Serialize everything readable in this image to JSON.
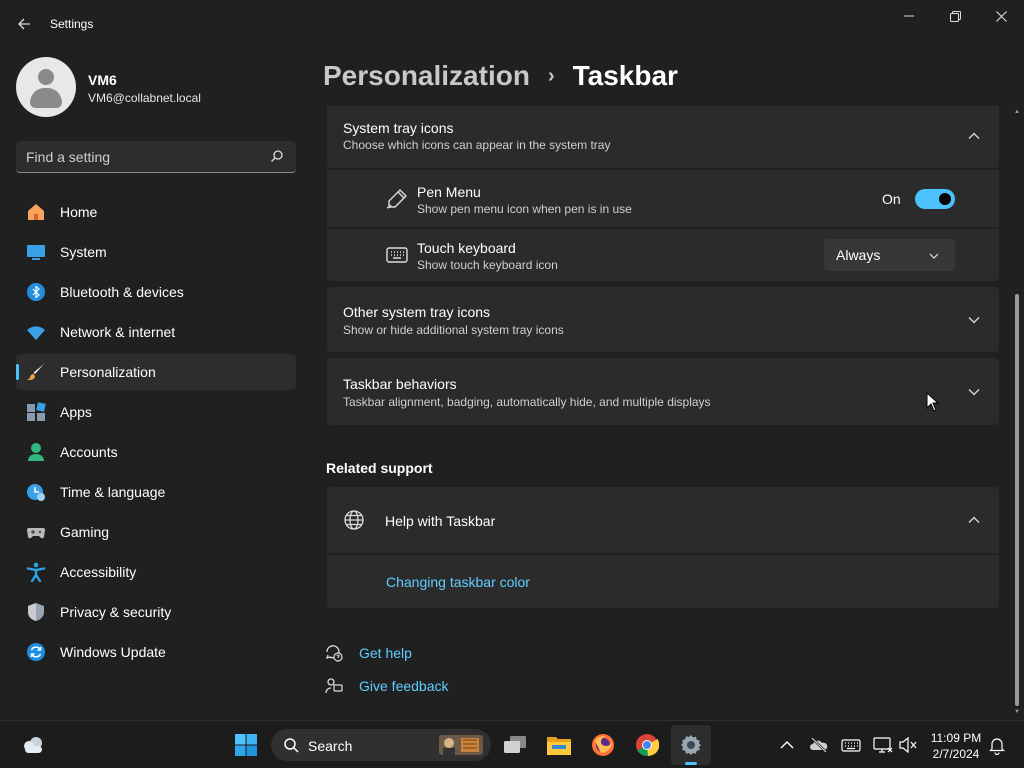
{
  "window": {
    "title": "Settings",
    "controls": [
      "minimize",
      "maximize",
      "close"
    ]
  },
  "profile": {
    "name": "VM6",
    "email": "VM6@collabnet.local"
  },
  "search": {
    "placeholder": "Find a setting"
  },
  "sidebar": {
    "items": [
      {
        "label": "Home",
        "icon": "home-icon"
      },
      {
        "label": "System",
        "icon": "system-icon"
      },
      {
        "label": "Bluetooth & devices",
        "icon": "bluetooth-icon"
      },
      {
        "label": "Network & internet",
        "icon": "wifi-icon"
      },
      {
        "label": "Personalization",
        "icon": "brush-icon",
        "active": true
      },
      {
        "label": "Apps",
        "icon": "apps-icon"
      },
      {
        "label": "Accounts",
        "icon": "accounts-icon"
      },
      {
        "label": "Time & language",
        "icon": "time-language-icon"
      },
      {
        "label": "Gaming",
        "icon": "gaming-icon"
      },
      {
        "label": "Accessibility",
        "icon": "accessibility-icon"
      },
      {
        "label": "Privacy & security",
        "icon": "shield-icon"
      },
      {
        "label": "Windows Update",
        "icon": "update-icon"
      }
    ]
  },
  "breadcrumb": {
    "parent": "Personalization",
    "separator": "›",
    "current": "Taskbar"
  },
  "system_tray": {
    "title": "System tray icons",
    "subtitle": "Choose which icons can appear in the system tray",
    "expanded": true,
    "pen_menu": {
      "title": "Pen Menu",
      "subtitle": "Show pen menu icon when pen is in use",
      "state_label": "On",
      "on": true
    },
    "touch_keyboard": {
      "title": "Touch keyboard",
      "subtitle": "Show touch keyboard icon",
      "value": "Always"
    }
  },
  "other_tray": {
    "title": "Other system tray icons",
    "subtitle": "Show or hide additional system tray icons"
  },
  "behaviors": {
    "title": "Taskbar behaviors",
    "subtitle": "Taskbar alignment, badging, automatically hide, and multiple displays"
  },
  "related": {
    "heading": "Related support",
    "help_title": "Help with Taskbar",
    "help_link": "Changing taskbar color"
  },
  "footer_links": {
    "get_help": "Get help",
    "give_feedback": "Give feedback"
  },
  "taskbar": {
    "search_label": "Search",
    "apps": [
      "start-icon",
      "task-view-icon",
      "file-explorer-icon",
      "firefox-icon",
      "chrome-icon",
      "settings-app-icon"
    ],
    "time": "11:09 PM",
    "date": "2/7/2024"
  },
  "colors": {
    "accent": "#4cc2ff",
    "link": "#60cdff",
    "background": "#202020",
    "card": "#2b2b2b"
  }
}
